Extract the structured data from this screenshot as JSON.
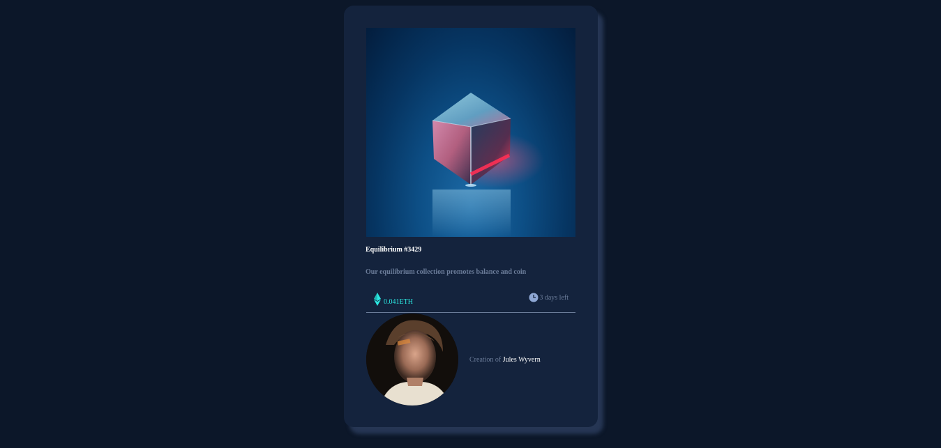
{
  "card": {
    "image_alt": "glass cube",
    "title": "Equilibrium #3429",
    "description": "Our equilibrium collection promotes balance and coin",
    "price": "0.041ETH",
    "price_icon": "ethereum-icon",
    "time_left": "3 days left",
    "time_icon": "clock-icon",
    "creator_prefix": "Creation of ",
    "creator_name": "Jules Wyvern"
  },
  "colors": {
    "page_bg": "#0c1729",
    "card_bg": "#14233d",
    "accent_cyan": "#2ce8e2",
    "muted_text": "#6b7c99",
    "white": "#ffffff"
  }
}
